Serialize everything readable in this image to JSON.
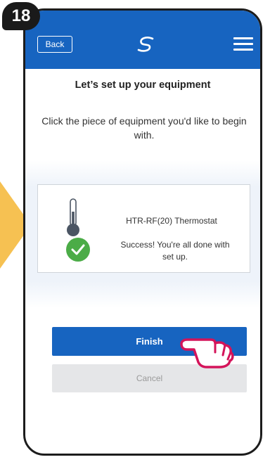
{
  "step_badge": "18",
  "header": {
    "back_label": "Back"
  },
  "main": {
    "title": "Let’s set up your equipment",
    "subtitle": "Click the piece of equipment you'd like to begin with."
  },
  "equipment": {
    "name": "HTR-RF(20) Thermostat",
    "status": "Success! You're all done with set up."
  },
  "buttons": {
    "finish": "Finish",
    "cancel": "Cancel"
  },
  "colors": {
    "brand_blue": "#1764c0",
    "success_green": "#4bac47",
    "arrow_yellow": "#f6c152",
    "pointer_pink": "#d4145a"
  },
  "icons": [
    "menu-icon",
    "thermometer-icon",
    "checkmark-icon",
    "pointing-hand-icon",
    "logo-icon"
  ]
}
